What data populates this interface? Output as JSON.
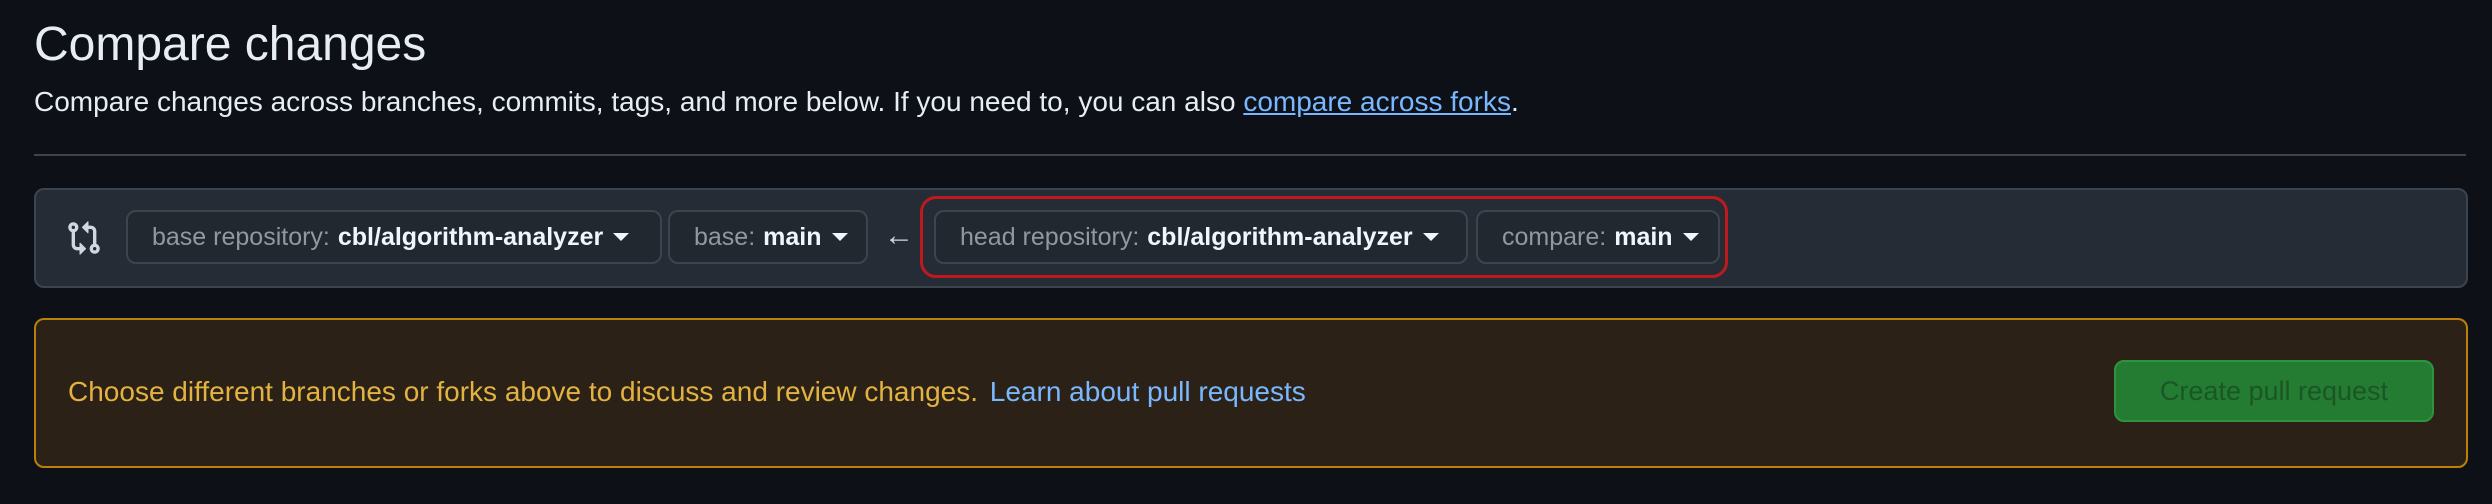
{
  "header": {
    "title": "Compare changes",
    "subtitle_prefix": "Compare changes across branches, commits, tags, and more below. If you need to, you can also ",
    "subtitle_link": "compare across forks",
    "subtitle_suffix": "."
  },
  "range_editor": {
    "icon": "git-compare-icon",
    "base_repository": {
      "label": "base repository:",
      "value": "cbl/algorithm-analyzer"
    },
    "base": {
      "label": "base:",
      "value": "main"
    },
    "arrow": "←",
    "head_repository": {
      "label": "head repository:",
      "value": "cbl/algorithm-analyzer"
    },
    "compare": {
      "label": "compare:",
      "value": "main"
    }
  },
  "flash": {
    "message": "Choose different branches or forks above to discuss and review changes.",
    "link": "Learn about pull requests",
    "button_label": "Create pull request"
  },
  "colors": {
    "background": "#0d1117",
    "link": "#79b8ff",
    "warning_text": "#e3b341",
    "primary_button": "#238636",
    "highlight_outline": "#c0191d"
  }
}
